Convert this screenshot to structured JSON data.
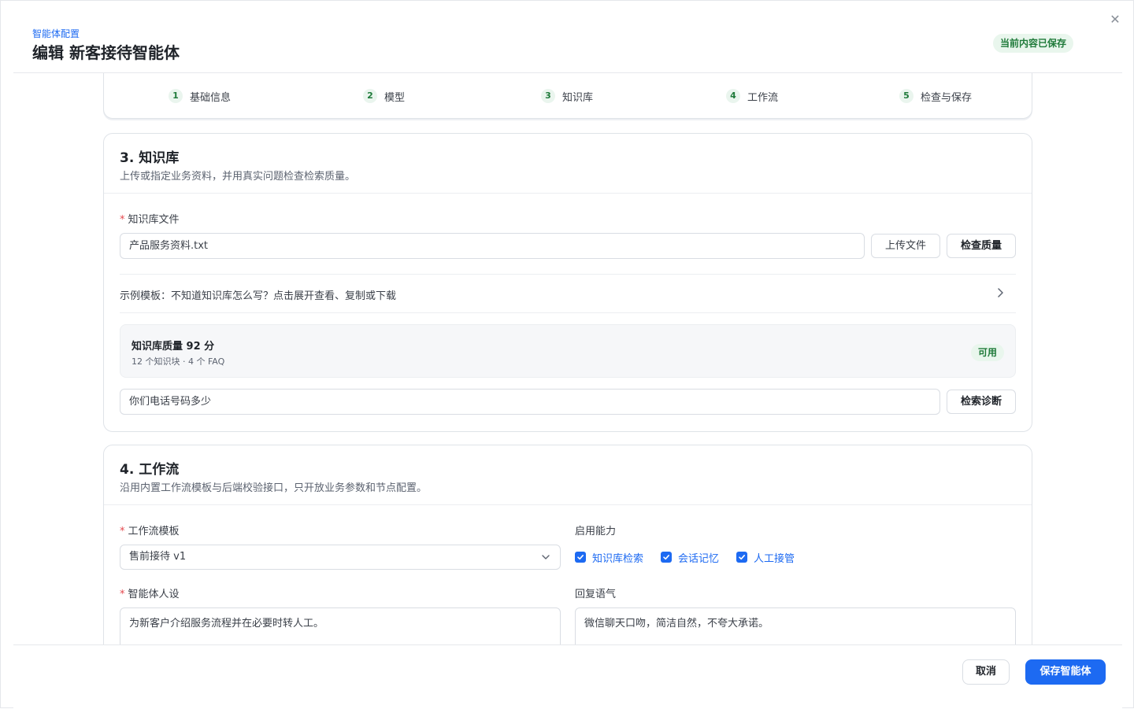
{
  "header": {
    "eyebrow": "智能体配置",
    "title": "编辑 新客接待智能体",
    "saved_badge": "当前内容已保存"
  },
  "steps": [
    {
      "num": "1",
      "label": "基础信息"
    },
    {
      "num": "2",
      "label": "模型"
    },
    {
      "num": "3",
      "label": "知识库"
    },
    {
      "num": "4",
      "label": "工作流"
    },
    {
      "num": "5",
      "label": "检查与保存"
    }
  ],
  "knowledge": {
    "title": "3. 知识库",
    "desc": "上传或指定业务资料，并用真实问题检查检索质量。",
    "file_label": "知识库文件",
    "file_value": "产品服务资料.txt",
    "upload_button": "上传文件",
    "check_button": "检查质量",
    "template_text": "示例模板：不知道知识库怎么写？点击展开查看、复制或下载",
    "quality_title": "知识库质量 92 分",
    "quality_sub": "12 个知识块 · 4 个 FAQ",
    "quality_badge": "可用",
    "query_value": "你们电话号码多少",
    "diagnose_button": "检索诊断"
  },
  "workflow": {
    "title": "4. 工作流",
    "desc": "沿用内置工作流模板与后端校验接口，只开放业务参数和节点配置。",
    "template_label": "工作流模板",
    "template_value": "售前接待 v1",
    "capability_label": "启用能力",
    "capabilities": [
      {
        "label": "知识库检索",
        "checked": true
      },
      {
        "label": "会话记忆",
        "checked": true
      },
      {
        "label": "人工接管",
        "checked": true
      }
    ],
    "persona_label": "智能体人设",
    "persona_value": "为新客户介绍服务流程并在必要时转人工。",
    "tone_label": "回复语气",
    "tone_value": "微信聊天口吻，简洁自然，不夸大承诺。"
  },
  "footer": {
    "cancel": "取消",
    "save": "保存智能体"
  },
  "colors": {
    "accent": "#1d6af2",
    "success": "#1f7a3a",
    "success_bg": "#e9f6ed",
    "required": "#e5484d"
  }
}
